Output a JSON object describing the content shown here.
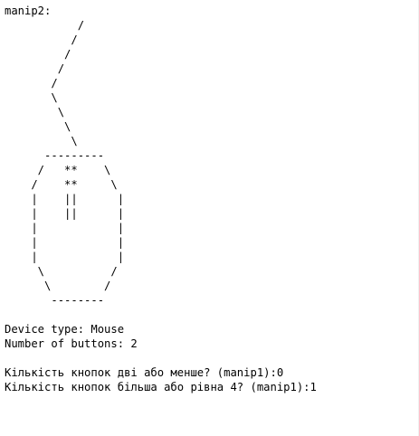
{
  "console": {
    "lines": [
      "manip2:",
      "           /",
      "          /",
      "         /",
      "        /",
      "       /",
      "       \\",
      "        \\",
      "         \\",
      "          \\",
      "      ---------",
      "     /   **    \\",
      "    /    **     \\",
      "    |    ||      |",
      "    |    ||      |",
      "    |            |",
      "    |            |",
      "    |            |",
      "     \\          /",
      "      \\        /",
      "       --------",
      "",
      "Device type: Mouse",
      "Number of buttons: 2",
      "",
      "Кількість кнопок дві або менше? (manip1):0",
      "Кількість кнопок більша або рівна 4? (manip1):1"
    ]
  }
}
